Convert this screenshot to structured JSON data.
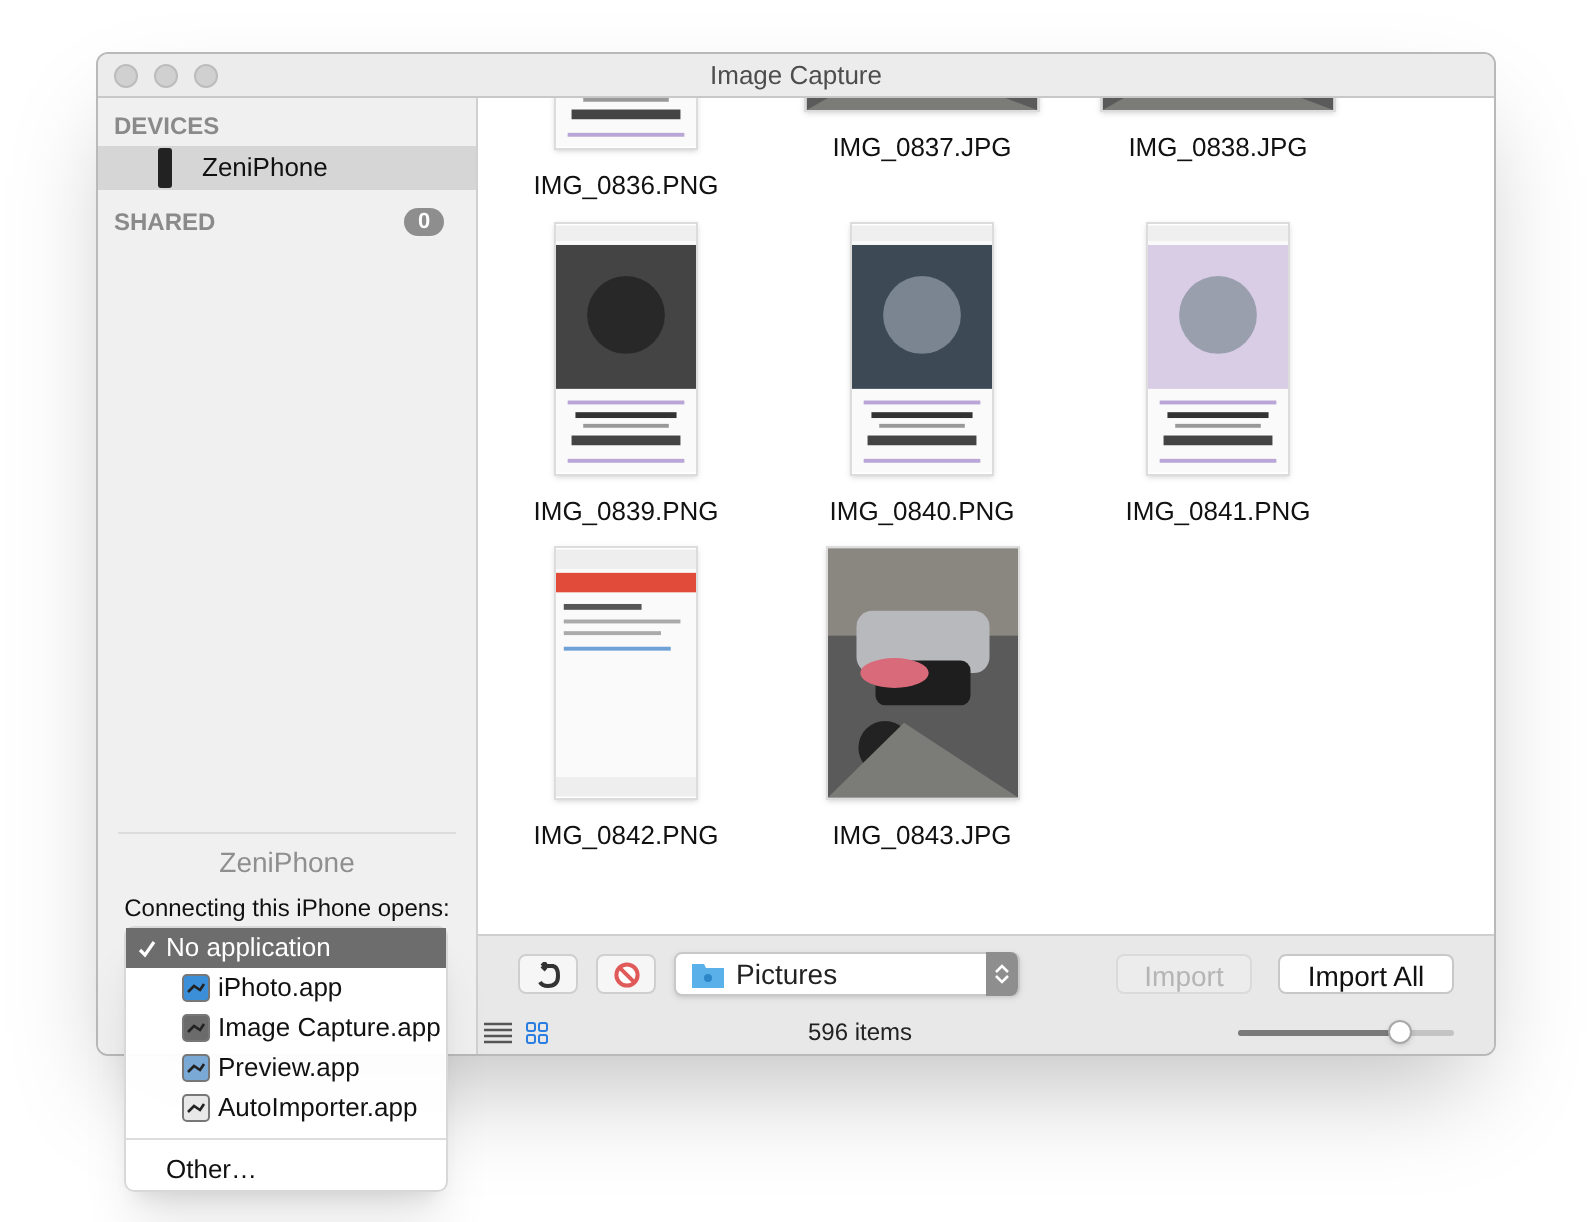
{
  "window": {
    "title": "Image Capture"
  },
  "sidebar": {
    "devices": {
      "heading": "DEVICES",
      "items": [
        {
          "label": "ZeniPhone",
          "selected": true
        }
      ]
    },
    "shared": {
      "heading": "SHARED",
      "count": "0"
    }
  },
  "device_panel": {
    "name": "ZeniPhone",
    "prompt": "Connecting this iPhone opens:"
  },
  "app_menu": {
    "groups": [
      [
        {
          "label": "No application",
          "kind": "none",
          "checked": true,
          "selected": true
        },
        {
          "label": "iPhoto.app",
          "kind": "app",
          "checked": false,
          "selected": false,
          "color": "#3a8fd8"
        },
        {
          "label": "Image Capture.app",
          "kind": "app",
          "checked": false,
          "selected": false,
          "color": "#6b6b6b"
        },
        {
          "label": "Preview.app",
          "kind": "app",
          "checked": false,
          "selected": false,
          "color": "#7aa9d6"
        },
        {
          "label": "AutoImporter.app",
          "kind": "app",
          "checked": false,
          "selected": false,
          "color": "#e8e8e8"
        }
      ],
      [
        {
          "label": "Other…",
          "kind": "none",
          "checked": false,
          "selected": false
        }
      ]
    ]
  },
  "thumbnails": [
    {
      "filename": "IMG_0836.PNG",
      "kind": "screenshot"
    },
    {
      "filename": "IMG_0837.JPG",
      "kind": "widephoto"
    },
    {
      "filename": "IMG_0838.JPG",
      "kind": "widephoto"
    },
    {
      "filename": "IMG_0839.PNG",
      "kind": "screenshot"
    },
    {
      "filename": "IMG_0840.PNG",
      "kind": "screenshot"
    },
    {
      "filename": "IMG_0841.PNG",
      "kind": "screenshot"
    },
    {
      "filename": "IMG_0842.PNG",
      "kind": "screenshot"
    },
    {
      "filename": "IMG_0843.JPG"
    }
  ],
  "toolbar": {
    "folder": "Pictures",
    "import": {
      "label": "Import",
      "disabled": true
    },
    "import_all": {
      "label": "Import All",
      "disabled": false
    }
  },
  "status_bar": {
    "views": [
      {
        "kind": "list",
        "selected": false
      },
      {
        "kind": "grid",
        "selected": true
      }
    ],
    "count": "596 items",
    "zoom": {
      "level": 0.78
    }
  }
}
